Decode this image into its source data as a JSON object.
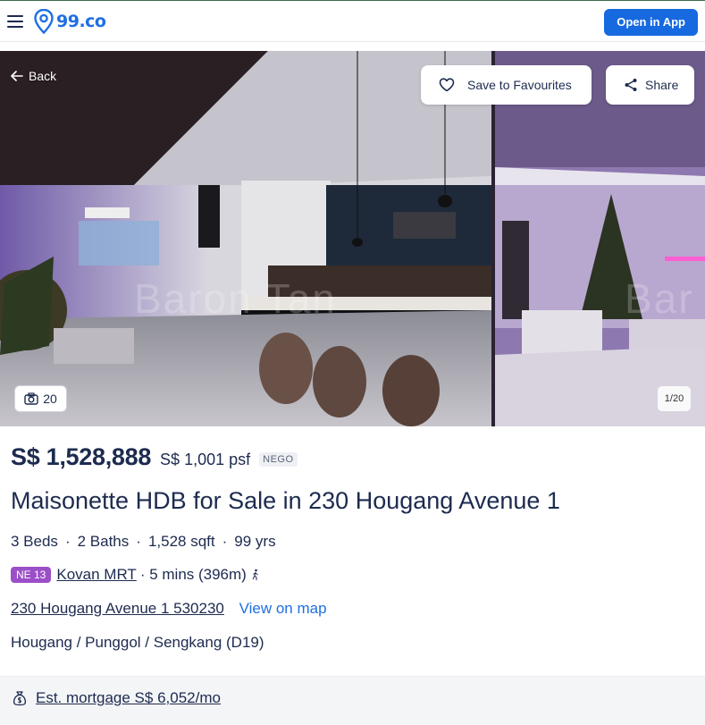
{
  "header": {
    "logo_text": "99.co",
    "open_app_label": "Open in App"
  },
  "gallery": {
    "back_label": "Back",
    "favourite_label": "Save to Favourites",
    "share_label": "Share",
    "photo_count": "20",
    "page_indicator": "1/20",
    "watermark": "Baron Tan"
  },
  "listing": {
    "price": "S$ 1,528,888",
    "psf": "S$ 1,001 psf",
    "nego_badge": "NEGO",
    "title": "Maisonette HDB for Sale in 230 Hougang Avenue 1",
    "beds": "3 Beds",
    "baths": "2 Baths",
    "size": "1,528 sqft",
    "tenure": "99 yrs",
    "mrt_code": "NE 13",
    "mrt_name": "Kovan MRT",
    "mrt_distance": "· 5 mins (396m)",
    "address": "230 Hougang Avenue 1 530230",
    "view_map_label": "View on map",
    "district": "Hougang / Punggol / Sengkang (D19)",
    "mortgage": "Est. mortgage S$ 6,052/mo"
  },
  "colors": {
    "brand_blue": "#1769e0",
    "mrt_badge": "#9b4fc7",
    "text_dark": "#1d2b4f"
  }
}
